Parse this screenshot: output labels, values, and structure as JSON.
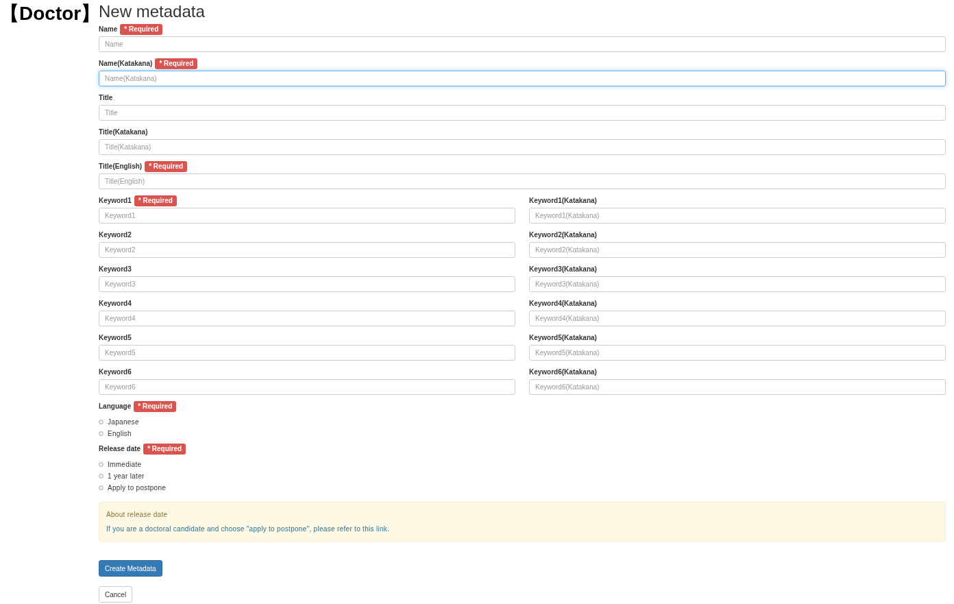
{
  "brand": "【Doctor】",
  "title": "New metadata",
  "field_rows": [
    {
      "columns": [
        {
          "label": "Name",
          "badge": "* Required",
          "placeholder": "Name",
          "focused": false
        }
      ]
    },
    {
      "columns": [
        {
          "label": "Name(Katakana)",
          "badge": "* Required",
          "placeholder": "Name(Katakana)",
          "focused": true
        }
      ]
    },
    {
      "columns": [
        {
          "label": "Title",
          "placeholder": "Title",
          "focused": false
        }
      ]
    },
    {
      "columns": [
        {
          "label": "Title(Katakana)",
          "placeholder": "Title(Katakana)",
          "focused": false
        }
      ]
    },
    {
      "columns": [
        {
          "label": "Title(English)",
          "badge": "* Required",
          "placeholder": "Title(English)",
          "focused": false
        }
      ]
    },
    {
      "columns": [
        {
          "label": "Keyword1",
          "badge": "* Required",
          "placeholder": "Keyword1",
          "focused": false
        },
        {
          "label": "Keyword1(Katakana)",
          "placeholder": "Keyword1(Katakana)",
          "focused": false
        }
      ]
    },
    {
      "columns": [
        {
          "label": "Keyword2",
          "placeholder": "Keyword2",
          "focused": false
        },
        {
          "label": "Keyword2(Katakana)",
          "placeholder": "Keyword2(Katakana)",
          "focused": false
        }
      ]
    },
    {
      "columns": [
        {
          "label": "Keyword3",
          "placeholder": "Keyword3",
          "focused": false
        },
        {
          "label": "Keyword3(Katakana)",
          "placeholder": "Keyword3(Katakana)",
          "focused": false
        }
      ]
    },
    {
      "columns": [
        {
          "label": "Keyword4",
          "placeholder": "Keyword4",
          "focused": false
        },
        {
          "label": "Keyword4(Katakana)",
          "placeholder": "Keyword4(Katakana)",
          "focused": false
        }
      ]
    },
    {
      "columns": [
        {
          "label": "Keyword5",
          "placeholder": "Keyword5",
          "focused": false
        },
        {
          "label": "Keyword5(Katakana)",
          "placeholder": "Keyword5(Katakana)",
          "focused": false
        }
      ]
    },
    {
      "columns": [
        {
          "label": "Keyword6",
          "placeholder": "Keyword6",
          "focused": false
        },
        {
          "label": "Keyword6(Katakana)",
          "placeholder": "Keyword6(Katakana)",
          "focused": false
        }
      ]
    }
  ],
  "radio_groups": [
    {
      "label": "Language",
      "badge": "* Required",
      "options": [
        {
          "label": "Japanese",
          "selected": false
        },
        {
          "label": "English",
          "selected": false
        }
      ]
    },
    {
      "label": "Release date",
      "badge": "* Required",
      "options": [
        {
          "label": "Immediate",
          "selected": false
        },
        {
          "label": "1 year later",
          "selected": false
        },
        {
          "label": "Apply to postpone",
          "selected": false
        }
      ]
    }
  ],
  "notice": {
    "title": "About release date",
    "text_before": "If you are a doctoral candidate and choose \"apply to postpone\", please refer to this ",
    "link": "link",
    "text_after": "."
  },
  "buttons": [
    {
      "label": "Create Metadata",
      "kind": "primary"
    },
    {
      "label": "Cancel",
      "kind": "default"
    }
  ]
}
